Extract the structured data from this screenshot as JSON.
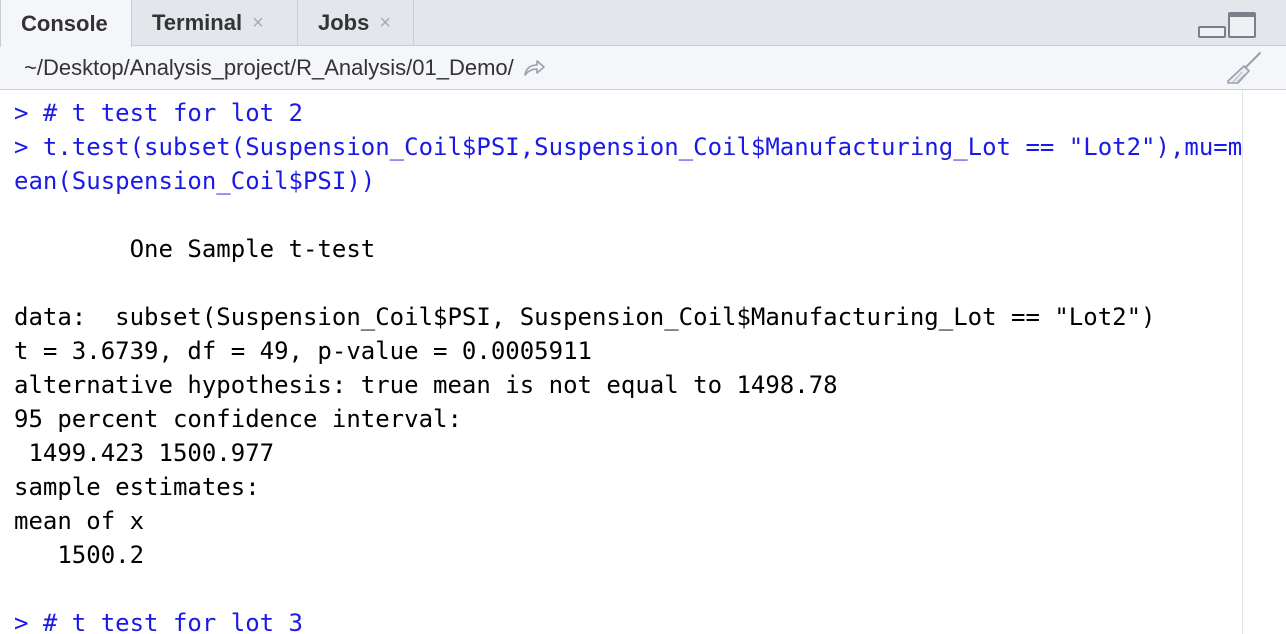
{
  "tabs": [
    {
      "label": "Console",
      "active": true,
      "closable": false
    },
    {
      "label": "Terminal",
      "active": false,
      "closable": true
    },
    {
      "label": "Jobs",
      "active": false,
      "closable": true
    }
  ],
  "close_glyph": "×",
  "path": "~/Desktop/Analysis_project/R_Analysis/01_Demo/",
  "colors": {
    "command": "#1a1ae6",
    "output": "#000000",
    "tabbar": "#e3e7ec"
  },
  "console_lines": [
    {
      "text": "> # t test for lot 2",
      "type": "cmd"
    },
    {
      "text": "> t.test(subset(Suspension_Coil$PSI,Suspension_Coil$Manufacturing_Lot == \"Lot2\"),mu=m",
      "type": "cmd"
    },
    {
      "text": "ean(Suspension_Coil$PSI))",
      "type": "cmd"
    },
    {
      "text": "",
      "type": "out"
    },
    {
      "text": "        One Sample t-test",
      "type": "out"
    },
    {
      "text": "",
      "type": "out"
    },
    {
      "text": "data:  subset(Suspension_Coil$PSI, Suspension_Coil$Manufacturing_Lot == \"Lot2\")",
      "type": "out"
    },
    {
      "text": "t = 3.6739, df = 49, p-value = 0.0005911",
      "type": "out"
    },
    {
      "text": "alternative hypothesis: true mean is not equal to 1498.78",
      "type": "out"
    },
    {
      "text": "95 percent confidence interval:",
      "type": "out"
    },
    {
      "text": " 1499.423 1500.977",
      "type": "out"
    },
    {
      "text": "sample estimates:",
      "type": "out"
    },
    {
      "text": "mean of x",
      "type": "out"
    },
    {
      "text": "   1500.2",
      "type": "out"
    },
    {
      "text": "",
      "type": "out"
    },
    {
      "text": "> # t test for lot 3",
      "type": "cmd"
    }
  ]
}
